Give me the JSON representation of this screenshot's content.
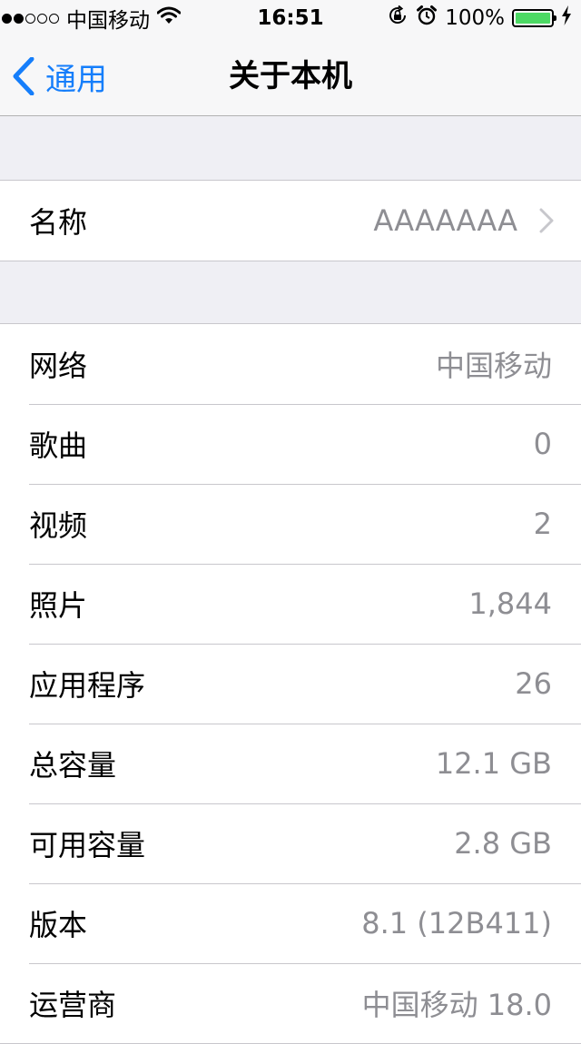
{
  "status_bar": {
    "carrier": "中国移动",
    "time": "16:51",
    "battery_text": "100%",
    "battery_level": 1.0,
    "signal_bars_filled": 2,
    "signal_bars_total": 5,
    "icons": [
      "wifi-icon",
      "rotation-lock-icon",
      "alarm-icon",
      "battery-icon",
      "charging-bolt-icon"
    ]
  },
  "nav": {
    "back_label": "通用",
    "title": "关于本机"
  },
  "name_row": {
    "label": "名称",
    "value": "AAAAAAA"
  },
  "info_rows": [
    {
      "label": "网络",
      "value": "中国移动"
    },
    {
      "label": "歌曲",
      "value": "0"
    },
    {
      "label": "视频",
      "value": "2"
    },
    {
      "label": "照片",
      "value": "1,844"
    },
    {
      "label": "应用程序",
      "value": "26"
    },
    {
      "label": "总容量",
      "value": "12.1 GB"
    },
    {
      "label": "可用容量",
      "value": "2.8 GB"
    },
    {
      "label": "版本",
      "value": "8.1 (12B411)"
    },
    {
      "label": "运营商",
      "value": "中国移动 18.0"
    }
  ],
  "colors": {
    "accent": "#157efb",
    "background": "#efeff4",
    "secondary_text": "#8e8e93",
    "battery": "#4cd964"
  }
}
